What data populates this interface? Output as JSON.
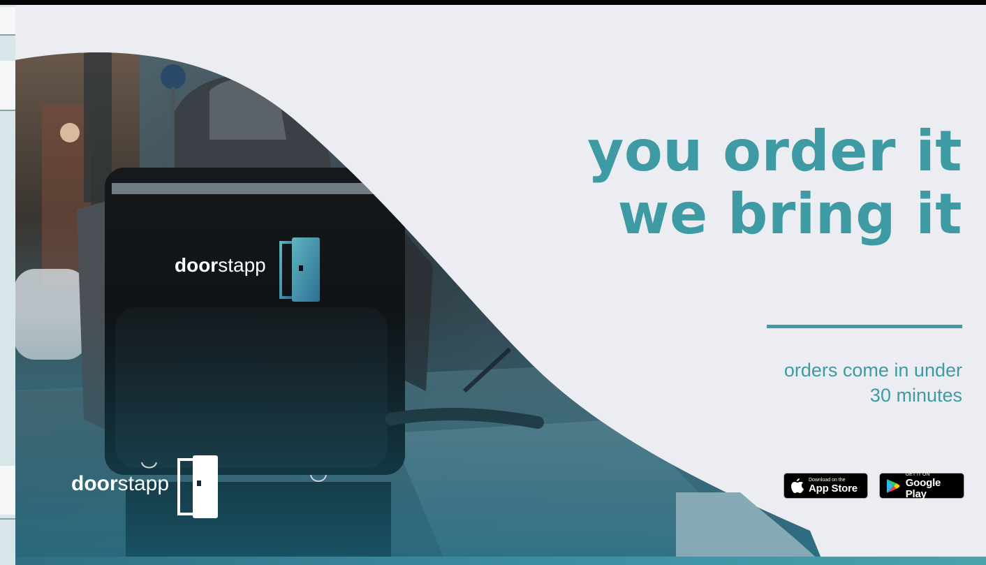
{
  "headline": {
    "line1": "you order it",
    "line2": "we bring it"
  },
  "subtext": {
    "line1": "orders come in under",
    "line2": "30 minutes"
  },
  "app_store": {
    "small": "Download on the",
    "big": "App Store"
  },
  "google_play": {
    "small": "GET IT ON",
    "big": "Google Play"
  },
  "bag_logo": {
    "bold": "door",
    "regular": "stapp"
  },
  "corner_logo": {
    "bold": "door",
    "regular": "stapp"
  },
  "colors": {
    "accent": "#3e9aa3",
    "background": "#ecedf2",
    "photo_dark": "#1a2a33"
  },
  "icons": [
    "apple-icon",
    "google-play-icon",
    "door-icon"
  ]
}
